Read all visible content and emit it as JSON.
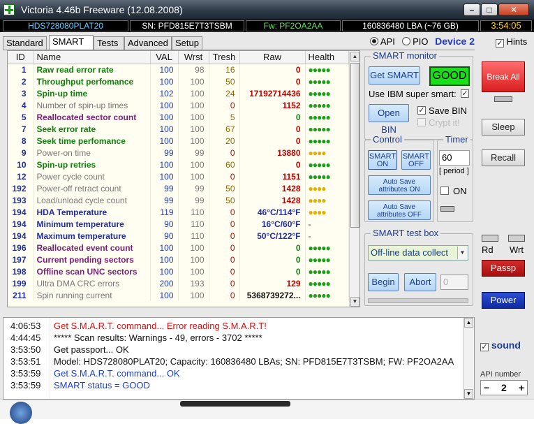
{
  "window": {
    "title": "Victoria 4.46b Freeware (12.08.2008)",
    "min": "–",
    "max": "□",
    "close": "✕"
  },
  "infobar": {
    "model": "HDS728080PLAT20",
    "sn": "SN: PFD815E7T3TSBM",
    "fw": "Fw: PF2OA2AA",
    "lba": "160836480 LBA (~76 GB)",
    "clock": "3:54:05"
  },
  "tabs": [
    "Standard",
    "SMART",
    "Tests",
    "Advanced",
    "Setup"
  ],
  "active_tab": "SMART",
  "mode": {
    "api": "API",
    "pio": "PIO",
    "device": "Device 2",
    "hints": "Hints",
    "hints_checked": "✓"
  },
  "table": {
    "headers": [
      "ID",
      "Name",
      "VAL",
      "Wrst",
      "Tresh",
      "Raw",
      "Health"
    ],
    "rows": [
      {
        "id": "1",
        "name": "Raw read error rate",
        "val": "100",
        "wrst": "98",
        "tresh": "16",
        "raw": "0",
        "health": "●●●●●",
        "nc": "c-green",
        "vc": "v-blue",
        "wc": "w-gray",
        "tc": "t-olive",
        "rc": "r-red",
        "hc": "h-green"
      },
      {
        "id": "2",
        "name": "Throughput perfomance",
        "val": "100",
        "wrst": "100",
        "tresh": "50",
        "raw": "0",
        "health": "●●●●●",
        "nc": "c-green",
        "vc": "v-blue",
        "wc": "w-gray",
        "tc": "t-olive",
        "rc": "r-red",
        "hc": "h-green"
      },
      {
        "id": "3",
        "name": "Spin-up time",
        "val": "102",
        "wrst": "100",
        "tresh": "24",
        "raw": "17192714436",
        "health": "●●●●●",
        "nc": "c-green",
        "vc": "v-blue",
        "wc": "w-gray",
        "tc": "t-olive",
        "rc": "r-red",
        "hc": "h-green"
      },
      {
        "id": "4",
        "name": "Number of spin-up times",
        "val": "100",
        "wrst": "100",
        "tresh": "0",
        "raw": "1152",
        "health": "●●●●●",
        "nc": "c-gray",
        "vc": "v-blue",
        "wc": "w-gray",
        "tc": "t-red",
        "rc": "r-red",
        "hc": "h-green"
      },
      {
        "id": "5",
        "name": "Reallocated sector count",
        "val": "100",
        "wrst": "100",
        "tresh": "5",
        "raw": "0",
        "health": "●●●●●",
        "nc": "c-purple",
        "vc": "v-blue",
        "wc": "w-gray",
        "tc": "t-olive",
        "rc": "r-green",
        "hc": "h-green"
      },
      {
        "id": "7",
        "name": "Seek error rate",
        "val": "100",
        "wrst": "100",
        "tresh": "67",
        "raw": "0",
        "health": "●●●●●",
        "nc": "c-green",
        "vc": "v-blue",
        "wc": "w-gray",
        "tc": "t-olive",
        "rc": "r-red",
        "hc": "h-green"
      },
      {
        "id": "8",
        "name": "Seek time perfomance",
        "val": "100",
        "wrst": "100",
        "tresh": "20",
        "raw": "0",
        "health": "●●●●●",
        "nc": "c-green",
        "vc": "v-blue",
        "wc": "w-gray",
        "tc": "t-olive",
        "rc": "r-red",
        "hc": "h-green"
      },
      {
        "id": "9",
        "name": "Power-on time",
        "val": "99",
        "wrst": "99",
        "tresh": "0",
        "raw": "13880",
        "health": "●●●●",
        "nc": "c-gray",
        "vc": "v-blue",
        "wc": "w-gray",
        "tc": "t-red",
        "rc": "r-red",
        "hc": "h-yellow"
      },
      {
        "id": "10",
        "name": "Spin-up retries",
        "val": "100",
        "wrst": "100",
        "tresh": "60",
        "raw": "0",
        "health": "●●●●●",
        "nc": "c-green",
        "vc": "v-blue",
        "wc": "w-gray",
        "tc": "t-olive",
        "rc": "r-red",
        "hc": "h-green"
      },
      {
        "id": "12",
        "name": "Power cycle count",
        "val": "100",
        "wrst": "100",
        "tresh": "0",
        "raw": "1151",
        "health": "●●●●●",
        "nc": "c-gray",
        "vc": "v-blue",
        "wc": "w-gray",
        "tc": "t-red",
        "rc": "r-red",
        "hc": "h-green"
      },
      {
        "id": "192",
        "name": "Power-off retract count",
        "val": "99",
        "wrst": "99",
        "tresh": "50",
        "raw": "1428",
        "health": "●●●●",
        "nc": "c-gray",
        "vc": "v-blue",
        "wc": "w-gray",
        "tc": "t-olive",
        "rc": "r-red",
        "hc": "h-yellow"
      },
      {
        "id": "193",
        "name": "Load/unload cycle count",
        "val": "99",
        "wrst": "99",
        "tresh": "50",
        "raw": "1428",
        "health": "●●●●",
        "nc": "c-gray",
        "vc": "v-blue",
        "wc": "w-gray",
        "tc": "t-olive",
        "rc": "r-red",
        "hc": "h-yellow"
      },
      {
        "id": "194",
        "name": "HDA Temperature",
        "val": "119",
        "wrst": "110",
        "tresh": "0",
        "raw": "46°C/114°F",
        "health": "●●●●",
        "nc": "c-navy",
        "vc": "v-blue",
        "wc": "w-gray",
        "tc": "t-red",
        "rc": "r-navy",
        "hc": "h-yellow"
      },
      {
        "id": "194",
        "name": "Minimum temperature",
        "val": "90",
        "wrst": "110",
        "tresh": "0",
        "raw": "16°C/60°F",
        "health": "-",
        "nc": "c-navy",
        "vc": "v-blue",
        "wc": "w-gray",
        "tc": "t-red",
        "rc": "r-navy",
        "hc": "h-dash"
      },
      {
        "id": "194",
        "name": "Maximum temperature",
        "val": "90",
        "wrst": "110",
        "tresh": "0",
        "raw": "50°C/122°F",
        "health": "-",
        "nc": "c-navy",
        "vc": "v-blue",
        "wc": "w-gray",
        "tc": "t-red",
        "rc": "r-navy",
        "hc": "h-dash"
      },
      {
        "id": "196",
        "name": "Reallocated event count",
        "val": "100",
        "wrst": "100",
        "tresh": "0",
        "raw": "0",
        "health": "●●●●●",
        "nc": "c-purple",
        "vc": "v-blue",
        "wc": "w-gray",
        "tc": "t-red",
        "rc": "r-green",
        "hc": "h-green"
      },
      {
        "id": "197",
        "name": "Current pending sectors",
        "val": "100",
        "wrst": "100",
        "tresh": "0",
        "raw": "0",
        "health": "●●●●●",
        "nc": "c-purple",
        "vc": "v-blue",
        "wc": "w-gray",
        "tc": "t-red",
        "rc": "r-green",
        "hc": "h-green"
      },
      {
        "id": "198",
        "name": "Offline scan UNC sectors",
        "val": "100",
        "wrst": "100",
        "tresh": "0",
        "raw": "0",
        "health": "●●●●●",
        "nc": "c-purple",
        "vc": "v-blue",
        "wc": "w-gray",
        "tc": "t-red",
        "rc": "r-green",
        "hc": "h-green"
      },
      {
        "id": "199",
        "name": "Ultra DMA CRC errors",
        "val": "200",
        "wrst": "193",
        "tresh": "0",
        "raw": "129",
        "health": "●●●●●",
        "nc": "c-gray",
        "vc": "v-blue",
        "wc": "w-gray",
        "tc": "t-red",
        "rc": "r-red",
        "hc": "h-green"
      },
      {
        "id": "211",
        "name": "Spin running current",
        "val": "100",
        "wrst": "100",
        "tresh": "0",
        "raw": "5368739272...",
        "health": "●●●●●",
        "nc": "c-gray",
        "vc": "v-blue",
        "wc": "w-gray",
        "tc": "t-red",
        "rc": "r-black",
        "hc": "h-green"
      }
    ]
  },
  "smart_monitor": {
    "legend": "SMART monitor",
    "get_smart": "Get SMART",
    "status": "GOOD",
    "use_ibm": "Use IBM super smart:",
    "open_bin": "Open BIN",
    "save_bin": "Save BIN",
    "crypt": "Crypt it!",
    "checked": "✓"
  },
  "control": {
    "legend": "Control",
    "smart_on": "SMART ON",
    "smart_off": "SMART OFF",
    "autosave_on": "Auto Save attributes ON",
    "autosave_off": "Auto Save attributes OFF"
  },
  "timer": {
    "legend": "Timer",
    "value": "60",
    "period": "[ period ]",
    "on_label": "ON"
  },
  "test_box": {
    "legend": "SMART test box",
    "selected": "Off-line data collect",
    "begin": "Begin",
    "abort": "Abort",
    "value": "0"
  },
  "right_panel": {
    "break_all": "Break All",
    "sleep": "Sleep",
    "recall": "Recall",
    "rd": "Rd",
    "wrt": "Wrt",
    "passp": "Passp",
    "power": "Power",
    "sound": "sound",
    "sound_checked": "✓",
    "api_number_label": "API number",
    "api_number": "2",
    "minus": "−",
    "plus": "+"
  },
  "log": [
    {
      "time": "4:06:53",
      "msg": "Get S.M.A.R.T. command... Error reading S.M.A.R.T!",
      "color": "m-red"
    },
    {
      "time": "4:44:45",
      "msg": "***** Scan results: Warnings - 49, errors - 3702 *****",
      "color": "m-black"
    },
    {
      "time": "3:53:50",
      "msg": "Get passport... OK",
      "color": "m-black"
    },
    {
      "time": "3:53:51",
      "msg": "Model: HDS728080PLAT20; Capacity: 160836480 LBAs; SN: PFD815E7T3TSBM; FW: PF2OA2AA",
      "color": "m-black"
    },
    {
      "time": "3:53:59",
      "msg": "Get S.M.A.R.T. command... OK",
      "color": "m-blue"
    },
    {
      "time": "3:53:59",
      "msg": "SMART status = GOOD",
      "color": "m-blue"
    }
  ],
  "icons": {
    "app": "victoria-cross-icon",
    "scroll_up": "▲",
    "scroll_down": "▼"
  }
}
